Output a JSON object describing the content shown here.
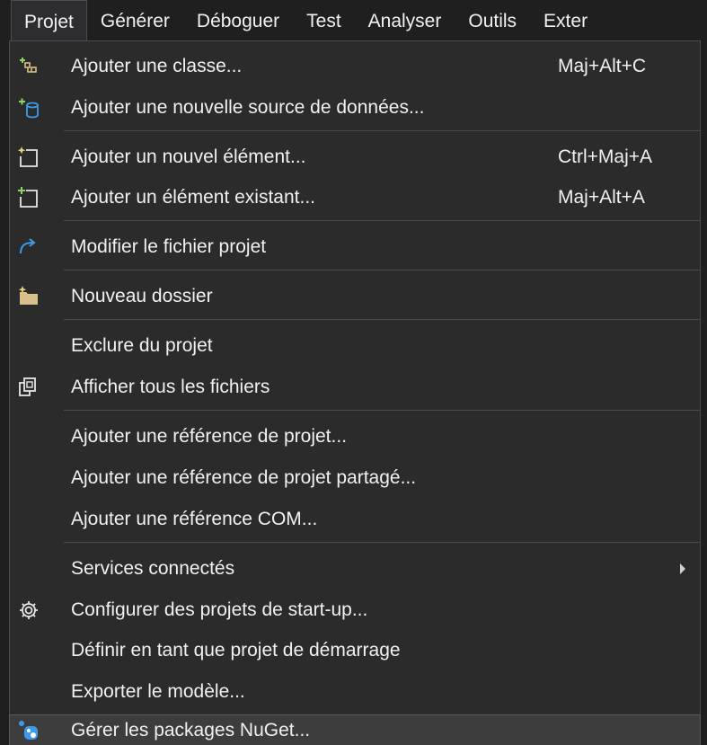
{
  "menubar": {
    "items": [
      {
        "label": "Projet",
        "active": true
      },
      {
        "label": "Générer"
      },
      {
        "label": "Déboguer"
      },
      {
        "label": "Test"
      },
      {
        "label": "Analyser"
      },
      {
        "label": "Outils"
      },
      {
        "label": "Exter"
      }
    ]
  },
  "menu": {
    "items": [
      {
        "label": "Ajouter une classe...",
        "shortcut": "Maj+Alt+C",
        "icon": "add-class-icon"
      },
      {
        "label": "Ajouter une nouvelle source de données...",
        "shortcut": "",
        "icon": "add-data-source-icon"
      },
      {
        "label": "Ajouter un nouvel élément...",
        "shortcut": "Ctrl+Maj+A",
        "icon": "new-item-icon"
      },
      {
        "label": "Ajouter un élément existant...",
        "shortcut": "Maj+Alt+A",
        "icon": "existing-item-icon"
      },
      {
        "label": "Modifier le fichier projet",
        "shortcut": "",
        "icon": "edit-project-icon"
      },
      {
        "label": "Nouveau dossier",
        "shortcut": "",
        "icon": "new-folder-icon"
      },
      {
        "label": "Exclure du projet",
        "shortcut": ""
      },
      {
        "label": "Afficher tous les fichiers",
        "shortcut": "",
        "icon": "show-all-files-icon"
      },
      {
        "label": "Ajouter une référence de projet...",
        "shortcut": ""
      },
      {
        "label": "Ajouter une référence de projet partagé...",
        "shortcut": ""
      },
      {
        "label": "Ajouter une référence COM...",
        "shortcut": ""
      },
      {
        "label": "Services connectés",
        "shortcut": "",
        "submenu": true
      },
      {
        "label": "Configurer des projets de start-up...",
        "shortcut": "",
        "icon": "gear-icon"
      },
      {
        "label": "Définir en tant que projet de démarrage",
        "shortcut": ""
      },
      {
        "label": "Exporter le modèle...",
        "shortcut": ""
      },
      {
        "label": "Gérer les packages NuGet...",
        "shortcut": "",
        "icon": "nuget-icon",
        "highlighted": true
      }
    ]
  },
  "colors": {
    "menu_background": "#2b2b2b",
    "menubar_background": "#1f1f1f",
    "text": "#f1f1f1",
    "icon_green": "#8bd36a",
    "icon_blue": "#3d9be9",
    "folder_tan": "#d9c08a"
  }
}
